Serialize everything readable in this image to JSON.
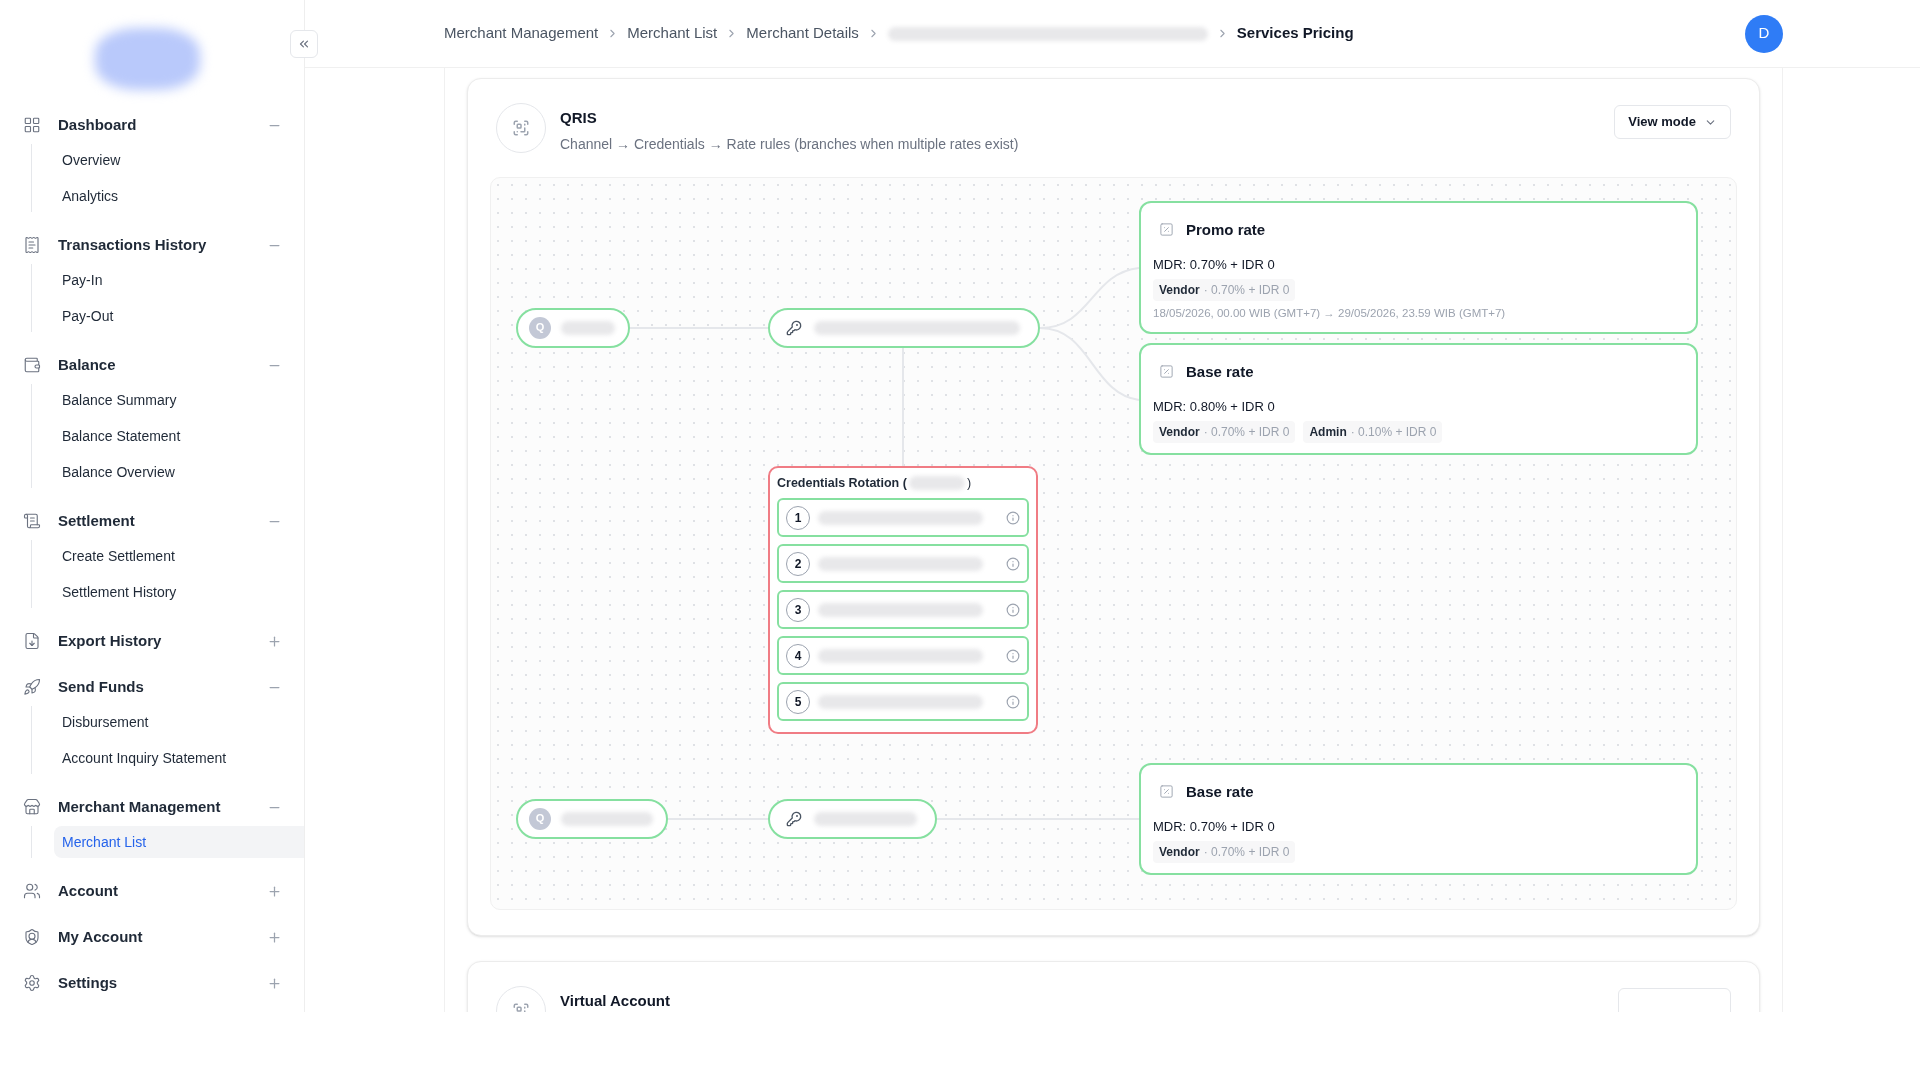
{
  "sidebar": {
    "groups": [
      {
        "label": "Dashboard",
        "expanded": true,
        "children": [
          {
            "label": "Overview",
            "selected": false
          },
          {
            "label": "Analytics",
            "selected": false
          }
        ]
      },
      {
        "label": "Transactions History",
        "expanded": true,
        "children": [
          {
            "label": "Pay-In",
            "selected": false
          },
          {
            "label": "Pay-Out",
            "selected": false
          }
        ]
      },
      {
        "label": "Balance",
        "expanded": true,
        "children": [
          {
            "label": "Balance Summary",
            "selected": false
          },
          {
            "label": "Balance Statement",
            "selected": false
          },
          {
            "label": "Balance Overview",
            "selected": false
          }
        ]
      },
      {
        "label": "Settlement",
        "expanded": true,
        "children": [
          {
            "label": "Create Settlement",
            "selected": false
          },
          {
            "label": "Settlement History",
            "selected": false
          }
        ]
      },
      {
        "label": "Export History",
        "expanded": false
      },
      {
        "label": "Send Funds",
        "expanded": true,
        "children": [
          {
            "label": "Disbursement",
            "selected": false
          },
          {
            "label": "Account Inquiry Statement",
            "selected": false
          }
        ]
      },
      {
        "label": "Merchant Management",
        "expanded": true,
        "children": [
          {
            "label": "Merchant List",
            "selected": true
          }
        ]
      },
      {
        "label": "Account",
        "expanded": false
      },
      {
        "label": "My Account",
        "expanded": false
      },
      {
        "label": "Settings",
        "expanded": false
      }
    ]
  },
  "breadcrumb": [
    "Merchant Management",
    "Merchant List",
    "Merchant Details",
    "Services Pricing"
  ],
  "avatar": "D",
  "sections": [
    {
      "title": "QRIS",
      "subtitle": "Channel → Credentials → Rate rules (branches when multiple rates exist)",
      "button": "View mode",
      "flows": [
        {
          "channel_letter": "Q",
          "rotation": {
            "title": "Credentials Rotation (",
            "close": ")",
            "items": [
              "1",
              "2",
              "3",
              "4",
              "5"
            ]
          },
          "rates": [
            {
              "title": "Promo rate",
              "mdr": "MDR: 0.70% + IDR 0",
              "parts": [
                {
                  "name": "Vendor",
                  "value": "· 0.70% + IDR 0"
                }
              ],
              "period": "18/05/2026, 00.00 WIB (GMT+7) → 29/05/2026, 23.59 WIB (GMT+7)"
            },
            {
              "title": "Base rate",
              "mdr": "MDR: 0.80% + IDR 0",
              "parts": [
                {
                  "name": "Vendor",
                  "value": "· 0.70% + IDR 0"
                },
                {
                  "name": "Admin",
                  "value": "· 0.10% + IDR 0"
                }
              ]
            }
          ]
        },
        {
          "channel_letter": "Q",
          "rates": [
            {
              "title": "Base rate",
              "mdr": "MDR: 0.70% + IDR 0",
              "parts": [
                {
                  "name": "Vendor",
                  "value": "· 0.70% + IDR 0"
                }
              ]
            }
          ]
        }
      ]
    },
    {
      "title": "Virtual Account"
    }
  ]
}
